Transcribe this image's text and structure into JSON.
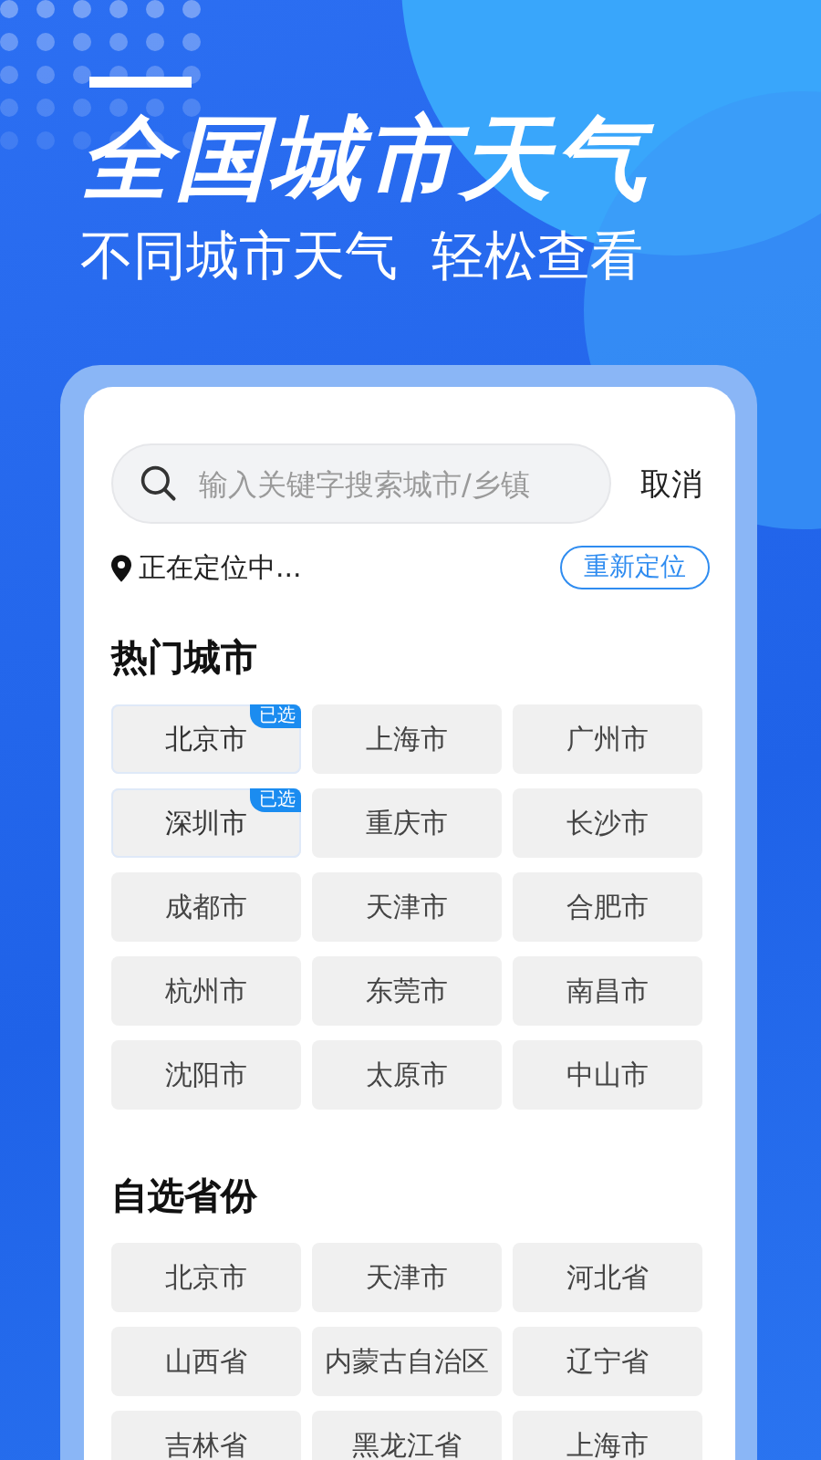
{
  "banner": {
    "title": "全国城市天气",
    "subtitle": "不同城市天气  轻松查看"
  },
  "search": {
    "placeholder": "输入关键字搜索城市/乡镇",
    "cancel": "取消"
  },
  "location": {
    "status": "正在定位中...",
    "relocate": "重新定位"
  },
  "sections": [
    {
      "title": "热门城市",
      "items": [
        {
          "label": "北京市",
          "selected": true,
          "badge": "已选"
        },
        {
          "label": "上海市",
          "selected": false
        },
        {
          "label": "广州市",
          "selected": false
        },
        {
          "label": "深圳市",
          "selected": true,
          "badge": "已选"
        },
        {
          "label": "重庆市",
          "selected": false
        },
        {
          "label": "长沙市",
          "selected": false
        },
        {
          "label": "成都市",
          "selected": false
        },
        {
          "label": "天津市",
          "selected": false
        },
        {
          "label": "合肥市",
          "selected": false
        },
        {
          "label": "杭州市",
          "selected": false
        },
        {
          "label": "东莞市",
          "selected": false
        },
        {
          "label": "南昌市",
          "selected": false
        },
        {
          "label": "沈阳市",
          "selected": false
        },
        {
          "label": "太原市",
          "selected": false
        },
        {
          "label": "中山市",
          "selected": false
        }
      ]
    },
    {
      "title": "自选省份",
      "items": [
        {
          "label": "北京市",
          "selected": false
        },
        {
          "label": "天津市",
          "selected": false
        },
        {
          "label": "河北省",
          "selected": false
        },
        {
          "label": "山西省",
          "selected": false
        },
        {
          "label": "内蒙古自治区",
          "selected": false
        },
        {
          "label": "辽宁省",
          "selected": false
        },
        {
          "label": "吉林省",
          "selected": false
        },
        {
          "label": "黑龙江省",
          "selected": false
        },
        {
          "label": "上海市",
          "selected": false
        }
      ]
    }
  ]
}
